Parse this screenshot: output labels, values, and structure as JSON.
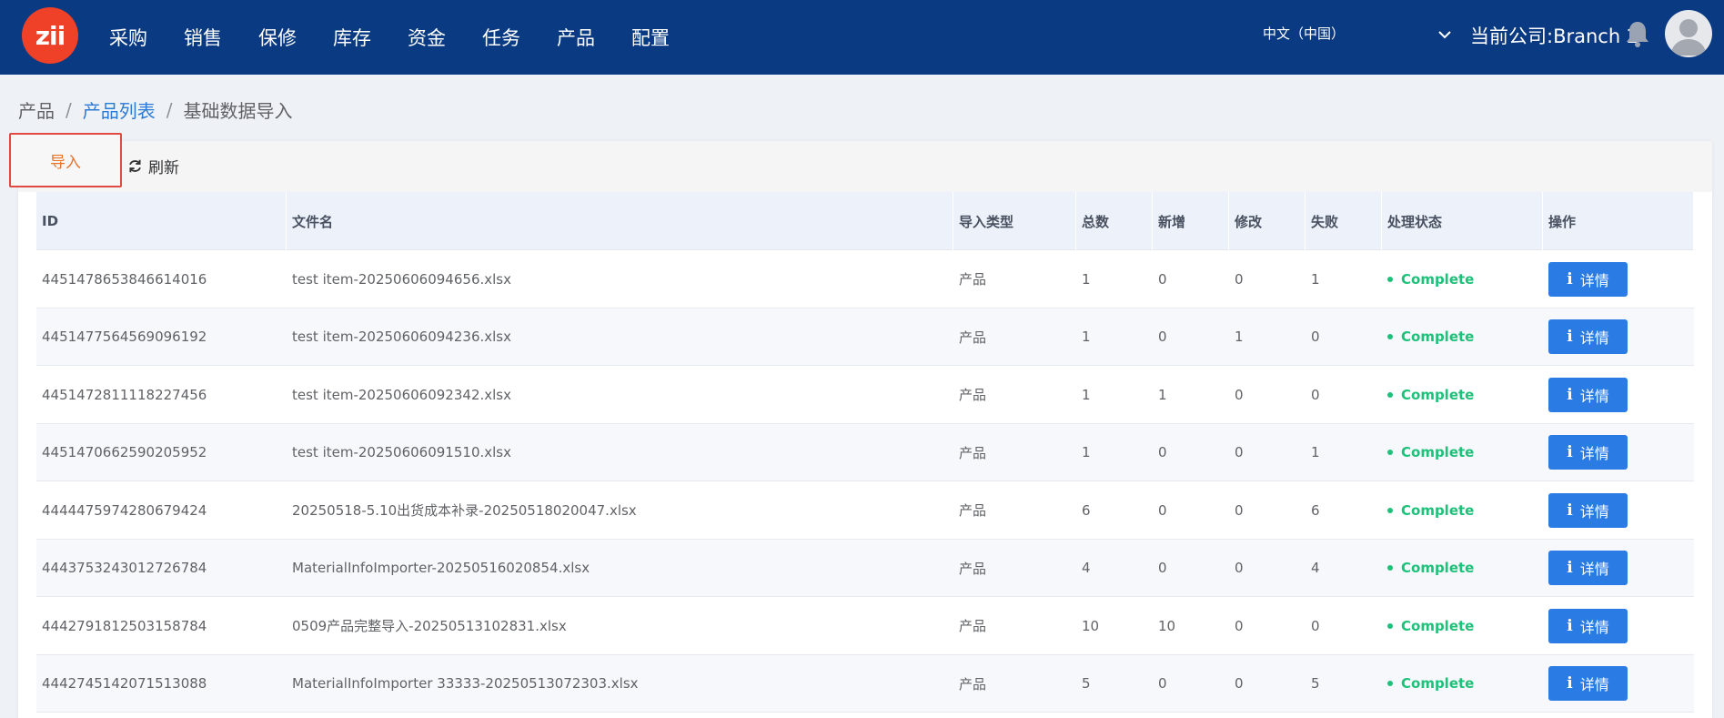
{
  "header": {
    "logo_text": "zii",
    "nav": [
      "采购",
      "销售",
      "保修",
      "库存",
      "资金",
      "任务",
      "产品",
      "配置"
    ],
    "language": "中文（中国）",
    "company": "当前公司:Branch 2"
  },
  "breadcrumb": {
    "root": "产品",
    "sep1": "/",
    "parent": "产品列表",
    "sep2": "/",
    "current": "基础数据导入"
  },
  "toolbar": {
    "import_label": "导入",
    "refresh_label": "刷新"
  },
  "table": {
    "headers": [
      "ID",
      "文件名",
      "导入类型",
      "总数",
      "新增",
      "修改",
      "失败",
      "处理状态",
      "操作"
    ],
    "detail_label": "详情",
    "info_glyph": "i",
    "status_color": "#1ec17a",
    "rows": [
      [
        "4451478653846614016",
        "test item-20250606094656.xlsx",
        "产品",
        "1",
        "0",
        "0",
        "1",
        "Complete"
      ],
      [
        "4451477564569096192",
        "test item-20250606094236.xlsx",
        "产品",
        "1",
        "0",
        "1",
        "0",
        "Complete"
      ],
      [
        "4451472811118227456",
        "test item-20250606092342.xlsx",
        "产品",
        "1",
        "1",
        "0",
        "0",
        "Complete"
      ],
      [
        "4451470662590205952",
        "test item-20250606091510.xlsx",
        "产品",
        "1",
        "0",
        "0",
        "1",
        "Complete"
      ],
      [
        "4444475974280679424",
        "20250518-5.10出货成本补录-20250518020047.xlsx",
        "产品",
        "6",
        "0",
        "0",
        "6",
        "Complete"
      ],
      [
        "4443753243012726784",
        "MaterialInfoImporter-20250516020854.xlsx",
        "产品",
        "4",
        "0",
        "0",
        "4",
        "Complete"
      ],
      [
        "4442791812503158784",
        "0509产品完整导入-20250513102831.xlsx",
        "产品",
        "10",
        "10",
        "0",
        "0",
        "Complete"
      ],
      [
        "4442745142071513088",
        "MaterialInfoImporter 33333-20250513072303.xlsx",
        "产品",
        "5",
        "0",
        "0",
        "5",
        "Complete"
      ]
    ]
  }
}
